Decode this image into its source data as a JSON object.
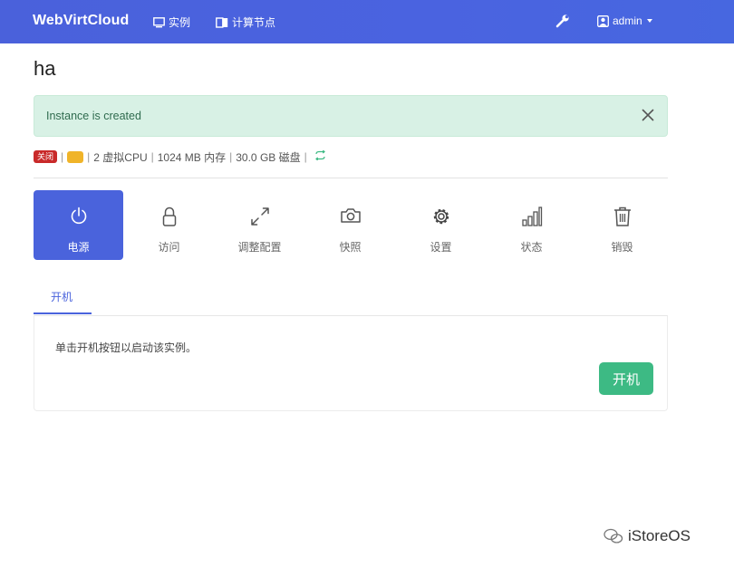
{
  "navbar": {
    "brand": "WebVirtCloud",
    "instances_label": "实例",
    "compute_label": "计算节点",
    "user_label": "admin"
  },
  "page": {
    "title": "ha"
  },
  "alert": {
    "message": "Instance is created"
  },
  "info": {
    "status_badge": "关闭",
    "vcpu_text": "2 虚拟CPU",
    "memory_text": "1024 MB 内存",
    "disk_text": "30.0 GB 磁盘"
  },
  "actions": [
    {
      "label": "电源",
      "icon": "power-icon",
      "active": true
    },
    {
      "label": "访问",
      "icon": "lock-icon",
      "active": false
    },
    {
      "label": "调整配置",
      "icon": "resize-icon",
      "active": false
    },
    {
      "label": "快照",
      "icon": "camera-icon",
      "active": false
    },
    {
      "label": "设置",
      "icon": "gear-icon",
      "active": false
    },
    {
      "label": "状态",
      "icon": "bar-chart-icon",
      "active": false
    },
    {
      "label": "销毁",
      "icon": "trash-icon",
      "active": false
    }
  ],
  "power_tab": {
    "subtab_label": "开机",
    "description": "单击开机按钮以启动该实例。",
    "start_button": "开机"
  },
  "watermark": {
    "text": "iStoreOS"
  },
  "colors": {
    "nav_bg": "#4a63e0",
    "accent": "#4a63dc",
    "alert_bg": "#d8f1e5",
    "success": "#3dba84",
    "danger": "#c92a2a",
    "warning": "#f0b429"
  }
}
